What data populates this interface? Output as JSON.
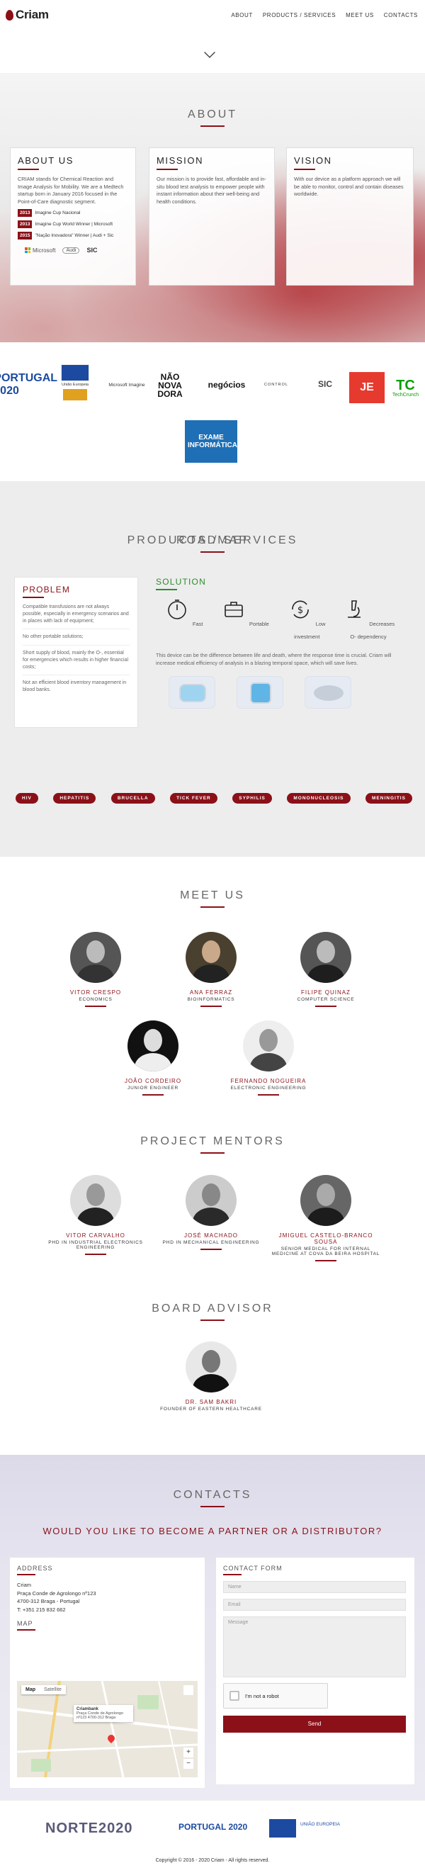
{
  "nav": {
    "brand": "Criam",
    "menu": [
      "ABOUT",
      "PRODUCTS / SERVICES",
      "MEET US",
      "CONTACTS"
    ]
  },
  "about": {
    "title": "ABOUT",
    "cards": [
      {
        "title": "ABOUT US",
        "text": "CRIAM stands for Chemical Reaction and Image Analysis for Mobility. We are a Medtech startup born in January 2016 focused in the Point-of-Care diagnostic segment."
      },
      {
        "title": "MISSION",
        "text": "Our mission is to provide fast, affordable and in-situ blood test analysis to empower people with instant information about their well-being and health conditions."
      },
      {
        "title": "VISION",
        "text": "With our device as a platform approach we will be able to monitor, control and contain diseases worldwide."
      }
    ],
    "awards": [
      {
        "year": "2013",
        "text": "Imagine Cup Nacional"
      },
      {
        "year": "2013",
        "text": "Imagine Cup World Winner | Microsoft"
      },
      {
        "year": "2015",
        "text": "\"Nação Inovadora\" Winner | Audi + Sic"
      }
    ],
    "award_logos": [
      "Microsoft",
      "Audi",
      "SIC"
    ]
  },
  "press": {
    "logos": [
      "PORTUGAL 2020",
      "União Europeia",
      "Microsoft Imagine",
      "NÃO NOVA DORA",
      "negócios",
      "CONTROL",
      "SIC",
      "JE",
      "TechCrunch",
      "EXAME INFORMÁTICA"
    ]
  },
  "products": {
    "title": "PRODUCTS / SERVICES",
    "problem": {
      "title": "PROBLEM",
      "items": [
        "Compatible transfusions are not always possible, especially in emergency scenarios and in places with lack of equipment;",
        "No other portable solutions;",
        "Short supply of blood, mainly the O-, essential for emergencies which results in higher financial costs;",
        "Not an efficient blood inventory management in blood banks."
      ]
    },
    "solution": {
      "title": "SOLUTION",
      "features": [
        {
          "label": "Fast",
          "icon": "timer-icon"
        },
        {
          "label": "Portable",
          "icon": "briefcase-icon"
        },
        {
          "label": "Low investment",
          "icon": "dollar-cycle-icon"
        },
        {
          "label": "Decreases O- dependency",
          "icon": "microscope-icon"
        }
      ],
      "text": "This device can be the difference between life and death, where the response time is crucial. Criam will increase medical efficiency of analysis in a blazing temporal space, which will save lives."
    },
    "roadmap": {
      "title": "ROADMAP",
      "items": [
        "HIV",
        "HEPATITIS",
        "BRUCELLA",
        "TICK FEVER",
        "SYPHILIS",
        "MONONUCLEOSIS",
        "MENINGITIS"
      ]
    }
  },
  "meet": {
    "title": "MEET US",
    "people": [
      {
        "name": "VITOR CRESPO",
        "role": "ECONOMICS"
      },
      {
        "name": "ANA FERRAZ",
        "role": "BIOINFORMATICS"
      },
      {
        "name": "FILIPE QUINAZ",
        "role": "COMPUTER SCIENCE"
      },
      {
        "name": "JOÃO CORDEIRO",
        "role": "JUNIOR ENGINEER"
      },
      {
        "name": "FERNANDO NOGUEIRA",
        "role": "ELECTRONIC ENGINEERING"
      }
    ]
  },
  "mentors": {
    "title": "PROJECT MENTORS",
    "people": [
      {
        "name": "VITOR CARVALHO",
        "role": "PHD IN INDUSTRIAL ELECTRONICS ENGINEERING"
      },
      {
        "name": "JOSÉ MACHADO",
        "role": "PHD IN MECHANICAL ENGINEERING"
      },
      {
        "name": "JMIGUEL CASTELO-BRANCO SOUSA",
        "role": "SENIOR MEDICAL FOR INTERNAL MEDICINE AT COVA DA BEIRA HOSPITAL"
      }
    ]
  },
  "advisor": {
    "title": "BOARD ADVISOR",
    "person": {
      "name": "DR. SAM BAKRI",
      "role": "FOUNDER OF EASTERN HEALTHCARE"
    }
  },
  "contacts": {
    "title": "CONTACTS",
    "partner": "WOULD YOU LIKE TO BECOME A PARTNER OR A DISTRIBUTOR?",
    "address": {
      "title": "ADDRESS",
      "lines": [
        "Criam",
        "Praça Conde de Agrolongo nº123",
        "4700-312 Braga - Portugal",
        "T: +351 215 832 662"
      ],
      "map_title": "MAP",
      "map_tabs": [
        "Map",
        "Satellite"
      ],
      "map_popup_title": "Criambank",
      "map_popup_text": "Praça Conde de Agrolongo nº123 4700-312 Braga"
    },
    "form": {
      "title": "CONTACT FORM",
      "name_placeholder": "Name",
      "email_placeholder": "Email",
      "message_placeholder": "Message",
      "captcha": "I'm not a robot",
      "send": "Send"
    }
  },
  "footer": {
    "fund_logos": [
      "NORTE2020",
      "PORTUGAL 2020",
      "UNIÃO EUROPEIA"
    ],
    "copyright": "Copyright © 2016 - 2020 Criam - All rights reserved."
  },
  "colors": {
    "brand": "#8b1018",
    "green": "#2e8b2e"
  }
}
